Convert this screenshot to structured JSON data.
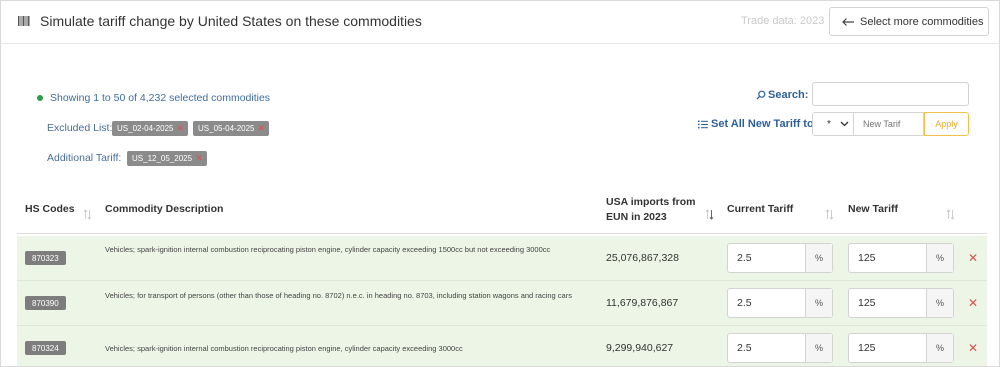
{
  "header": {
    "title": "Simulate tariff change by United States on these commodities",
    "trade_data": "Trade data: 2023",
    "select_more_label": "Select more commodities"
  },
  "filters": {
    "showing": "Showing 1 to 50 of 4,232 selected commodities",
    "excluded_label": "Excluded List:",
    "excluded_chips": [
      "US_02-04-2025",
      "US_05-04-2025"
    ],
    "additional_label": "Additional Tariff:",
    "additional_chips": [
      "US_12_05_2025"
    ]
  },
  "search": {
    "label": "Search:",
    "value": ""
  },
  "set_all": {
    "label": "Set All New Tariff to:",
    "operator": "*",
    "placeholder": "New Tarif",
    "apply_label": "Apply"
  },
  "table": {
    "columns": {
      "hs": "HS Codes",
      "desc": "Commodity Description",
      "imports_line1": "USA imports from",
      "imports_line2": "EUN in 2023",
      "current": "Current Tariff",
      "new": "New Tariff"
    },
    "rows": [
      {
        "hs": "870323",
        "desc": "Vehicles; spark-ignition internal combustion reciprocating piston engine, cylinder capacity exceeding 1500cc but not exceeding 3000cc",
        "imports": "25,076,867,328",
        "current": "2.5",
        "new": "125"
      },
      {
        "hs": "870390",
        "desc": "Vehicles; for transport of persons (other than those of heading no. 8702) n.e.c. in heading no. 8703, including station wagons and racing cars",
        "imports": "11,679,876,867",
        "current": "2.5",
        "new": "125"
      },
      {
        "hs": "870324",
        "desc": "Vehicles; spark-ignition internal combustion reciprocating piston engine, cylinder capacity exceeding 3000cc",
        "imports": "9,299,940,627",
        "current": "2.5",
        "new": "125"
      }
    ],
    "percent_symbol": "%",
    "remove_symbol": "✕"
  },
  "colors": {
    "accent": "#2e5f96",
    "row_bg": "#ecf5e6",
    "apply": "#e6a823",
    "remove": "#d9534f"
  }
}
